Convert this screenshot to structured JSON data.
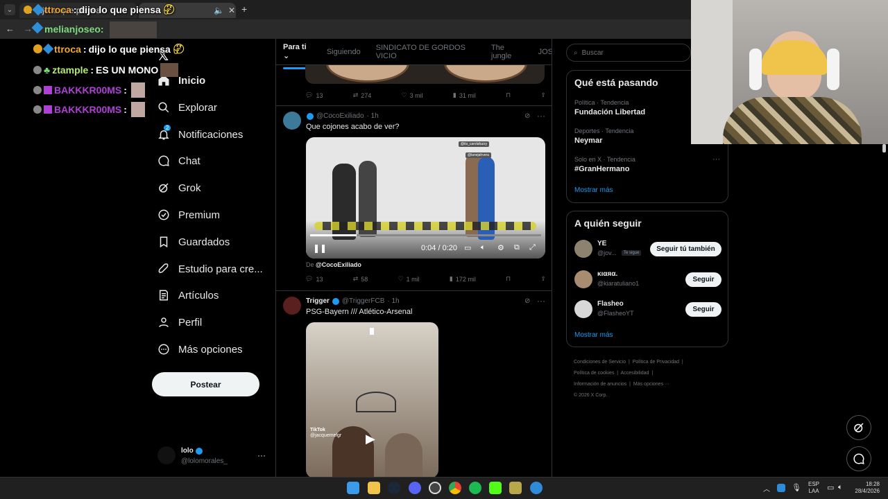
{
  "browser": {
    "tab1": "dijo lo que piensa",
    "address_text": "melianjoseo:"
  },
  "stream_chat": [
    {
      "user": "ttroca",
      "sep": ":",
      "msg": "dijo lo que piensa"
    },
    {
      "user": "ztample",
      "sep": ":",
      "msg": "ES UN MONO"
    },
    {
      "user": "BAKKKR00MS",
      "sep": ":",
      "msg": ""
    },
    {
      "user": "BAKKKR00MS",
      "sep": ":",
      "msg": ""
    }
  ],
  "overlay_top": {
    "user": "ttroca",
    "msg": "dijo lo que piensa",
    "user2": "melianjoseo:"
  },
  "sidebar": {
    "items": [
      {
        "label": "Inicio",
        "icon": "home-icon"
      },
      {
        "label": "Explorar",
        "icon": "search-icon"
      },
      {
        "label": "Notificaciones",
        "icon": "bell-icon",
        "badge": "2"
      },
      {
        "label": "Chat",
        "icon": "chat-icon"
      },
      {
        "label": "Grok",
        "icon": "grok-icon"
      },
      {
        "label": "Premium",
        "icon": "premium-icon"
      },
      {
        "label": "Guardados",
        "icon": "bookmark-icon"
      },
      {
        "label": "Estudio para cre...",
        "icon": "rocket-icon"
      },
      {
        "label": "Artículos",
        "icon": "article-icon"
      },
      {
        "label": "Perfil",
        "icon": "person-icon"
      },
      {
        "label": "Más opciones",
        "icon": "more-icon"
      }
    ],
    "post_button": "Postear",
    "account": {
      "name": "lolo",
      "handle": "@lolomorales_"
    }
  },
  "feed": {
    "tabs": [
      "Para ti",
      "Siguiendo",
      "SINDICATO DE GORDOS VICIO",
      "The jungle",
      "JOS"
    ],
    "post0_actions": {
      "replies": "13",
      "reposts": "274",
      "likes": "3 mil",
      "views": "31 mil"
    },
    "post1": {
      "handle": "@CocoExiliado",
      "time": "· 1h",
      "text": "Que cojones acabo de ver?",
      "video_time": "0:04 / 0:20",
      "source_prefix": "De",
      "source": "@CocoExiliado",
      "video_tag1": "@its_carolafuzzy",
      "video_tag2": "@lanejahvera",
      "actions": {
        "replies": "13",
        "reposts": "58",
        "likes": "1 mil",
        "views": "172 mil"
      }
    },
    "post2": {
      "name": "Trigger",
      "handle": "@TriggerFCB",
      "time": "· 1h",
      "text": "PSG-Bayern /// Atlético-Arsenal",
      "video_brand": "TikTok",
      "video_brand_handle": "@jacquemelgr"
    }
  },
  "right": {
    "search_placeholder": "Buscar",
    "trends_title": "Qué está pasando",
    "trends": [
      {
        "cat": "Política · Tendencia",
        "name": "Fundación Libertad"
      },
      {
        "cat": "Deportes · Tendencia",
        "name": "Neymar"
      },
      {
        "cat": "Solo en X · Tendencia",
        "name": "#GranHermano"
      }
    ],
    "show_more": "Mostrar más",
    "follow_title": "A quién seguir",
    "follow": [
      {
        "name": "YE",
        "handle": "@jov...",
        "badge": "Te sigue",
        "btn": "Seguir tú también"
      },
      {
        "name": "κιαяα.",
        "handle": "@kiaratuliano1",
        "btn": "Seguir"
      },
      {
        "name": "Flasheo",
        "handle": "@FlasheoYT",
        "btn": "Seguir"
      }
    ],
    "show_more2": "Mostrar más",
    "footer": [
      "Condiciones de Servicio",
      "Política de Privacidad",
      "Política de cookies",
      "Accesibilidad",
      "Información de anuncios",
      "Más opciones ···",
      "© 2026 X Corp."
    ]
  },
  "taskbar": {
    "lang1": "ESP",
    "lang2": "LAA",
    "time": "18:28",
    "date": "28/4/2026"
  },
  "colors": {
    "accent": "#1d9bf0",
    "bg": "#000000",
    "border": "#2f3336",
    "muted": "#71767b"
  }
}
